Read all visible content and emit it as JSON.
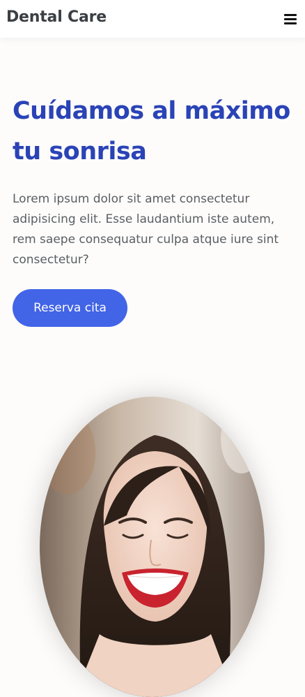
{
  "header": {
    "brand": "Dental Care",
    "menu_icon": "hamburger-menu-icon"
  },
  "hero": {
    "title": "Cuídamos al máximo tu sonrisa",
    "description": "Lorem ipsum dolor sit amet consectetur adipisicing elit. Esse laudantium iste autem, rem saepe consequatur culpa atque iure sint consectetur?",
    "cta_label": "Reserva cita"
  },
  "colors": {
    "accent_title": "#2a43b6",
    "accent_button": "#4264e6",
    "text": "#5a5e62",
    "background": "#fdfcfb"
  }
}
